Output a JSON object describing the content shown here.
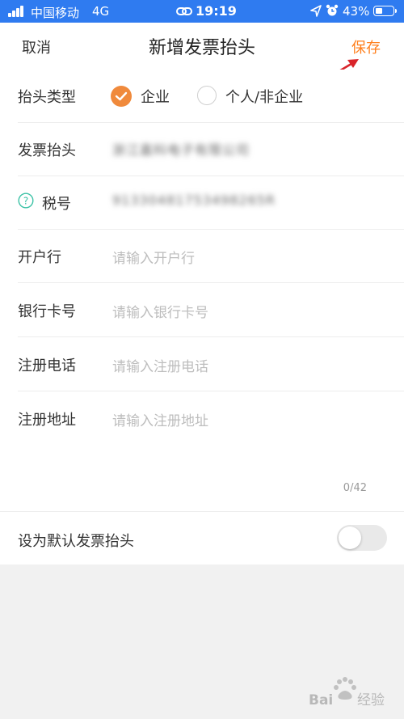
{
  "status_bar": {
    "carrier": "中国移动",
    "network": "4G",
    "time": "19:19",
    "battery": "43%",
    "battery_level": 0.43,
    "icons": [
      "signal-icon",
      "link-icon",
      "location-icon",
      "alarm-icon",
      "battery-icon"
    ]
  },
  "nav": {
    "cancel": "取消",
    "title": "新增发票抬头",
    "save": "保存"
  },
  "form": {
    "type": {
      "label": "抬头类型",
      "options": [
        {
          "label": "企业",
          "selected": true
        },
        {
          "label": "个人/非企业",
          "selected": false
        }
      ]
    },
    "invoice_title": {
      "label": "发票抬头",
      "value": "浙江嘉科电子有限公司"
    },
    "tax_id": {
      "label": "税号",
      "value": "91330481753498265R"
    },
    "bank": {
      "label": "开户行",
      "placeholder": "请输入开户行"
    },
    "bank_card": {
      "label": "银行卡号",
      "placeholder": "请输入银行卡号"
    },
    "reg_phone": {
      "label": "注册电话",
      "placeholder": "请输入注册电话"
    },
    "reg_address": {
      "label": "注册地址",
      "placeholder": "请输入注册地址"
    },
    "address_counter": "0/42"
  },
  "default_row": {
    "label": "设为默认发票抬头",
    "toggle_on": false
  },
  "colors": {
    "status_bar": "#2f7bf0",
    "accent": "#ff7f1c",
    "radio": "#f08a3c",
    "annotation_arrow": "#d9242a"
  }
}
